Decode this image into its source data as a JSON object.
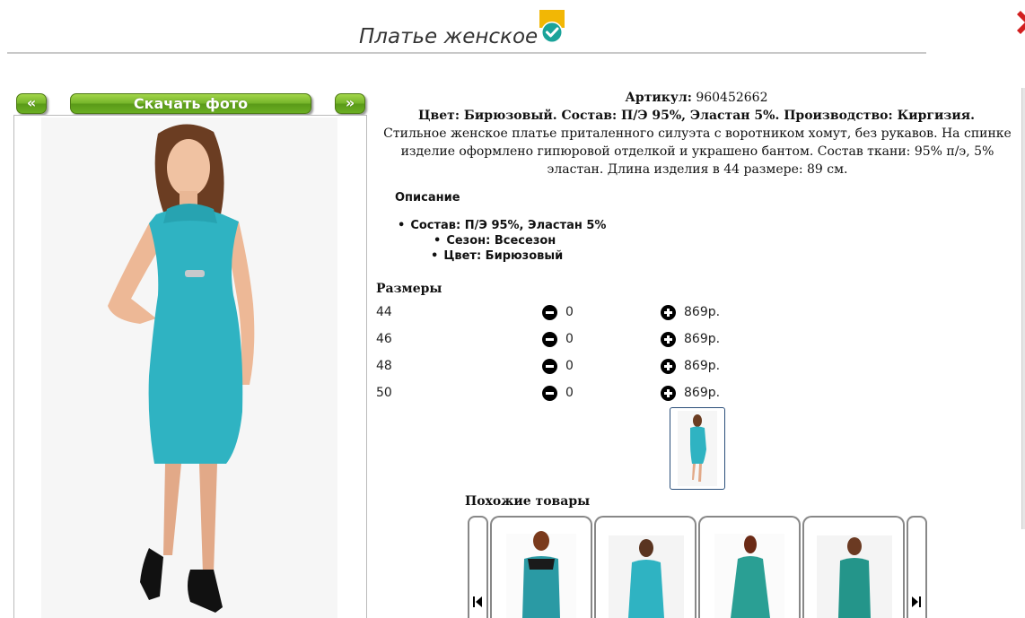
{
  "product": {
    "title": "Платье женское",
    "badge_icon": "verified-check-icon"
  },
  "gallery": {
    "prev_label": "«",
    "download_label": "Скачать фото",
    "next_label": "»"
  },
  "info": {
    "article_label": "Артикул:",
    "article_value": "960452662",
    "color_line": "Цвет: Бирюзовый. Состав: П/Э 95%, Эластан 5%. Производство: Киргизия.",
    "description": "Стильное женское платье приталенного силуэта с воротником хомут, без рукавов. На спинке изделие оформлено гипюровой отделкой и украшено бантом. Состав ткани: 95% п/э, 5% эластан. Длина изделия в 44 размере: 89 см."
  },
  "opisanie": {
    "heading": "Описание",
    "items": [
      "Состав: П/Э 95%, Эластан 5%",
      "Сезон: Всесезон",
      "Цвет: Бирюзовый"
    ]
  },
  "sizes": {
    "heading": "Размеры",
    "rows": [
      {
        "size": "44",
        "qty": "0",
        "price": "869р."
      },
      {
        "size": "46",
        "qty": "0",
        "price": "869р."
      },
      {
        "size": "48",
        "qty": "0",
        "price": "869р."
      },
      {
        "size": "50",
        "qty": "0",
        "price": "869р."
      }
    ]
  },
  "similar": {
    "heading": "Похожие товары",
    "prev_icon": "skip-prev-icon",
    "next_icon": "skip-next-icon"
  },
  "colors": {
    "dress": "#2fb3c2",
    "button_green": "#6aae22"
  }
}
